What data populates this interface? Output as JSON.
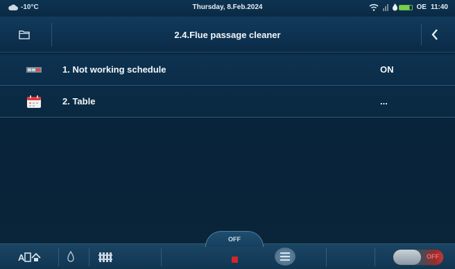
{
  "status_bar": {
    "temperature": "-10°C",
    "date": "Thursday, 8.Feb.2024",
    "mode": "OE",
    "time": "11:40"
  },
  "header": {
    "title": "2.4.Flue passage cleaner"
  },
  "list": {
    "items": [
      {
        "label": "1. Not working schedule",
        "value": "ON",
        "icon": "schedule-icon"
      },
      {
        "label": "2. Table",
        "value": "...",
        "icon": "calendar-icon"
      }
    ]
  },
  "bottom_bar": {
    "off_label": "OFF",
    "toggle_label": "OFF"
  },
  "colors": {
    "background": "#08233a",
    "accent_red": "#d42626",
    "fuel_green": "#76d04a"
  }
}
